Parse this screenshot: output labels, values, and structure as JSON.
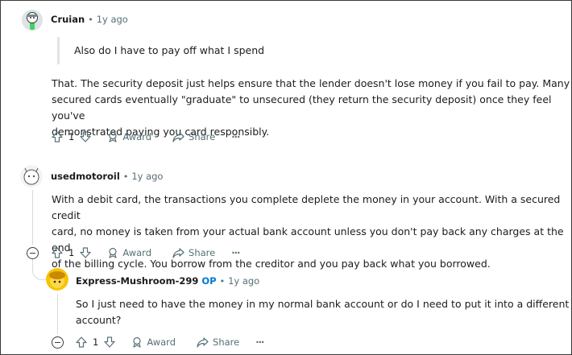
{
  "comments": [
    {
      "author": "Cruian",
      "age": "1y ago",
      "quote": "Also do I have to pay off what I spend",
      "body": [
        "That. The security deposit just helps ensure that the lender doesn't lose money if you fail to pay. Many",
        "secured cards eventually \"graduate\" to unsecured (they return the security deposit) once they feel you've",
        "demonstrated paying you card responsibly."
      ],
      "votes": "1"
    },
    {
      "author": "usedmotoroil",
      "age": "1y ago",
      "body": [
        "With a debit card, the transactions you complete deplete the money in your account. With a secured credit",
        "card, no money is taken from your actual bank account unless you don't pay back any charges at the end",
        "of the billing cycle. You borrow from the creditor and you pay back what you borrowed."
      ],
      "votes": "1"
    },
    {
      "author": "Express-Mushroom-299",
      "badge": "OP",
      "age": "1y ago",
      "body": [
        "So I just need to have the money in my normal bank account or do I need to put it into a different",
        "account?"
      ],
      "votes": "1"
    }
  ],
  "actions": {
    "award_label": "Award",
    "share_label": "Share",
    "more_label": "···"
  },
  "separator": "•",
  "colors": {
    "meta_gray": "#576f76",
    "op_blue": "#0079d3",
    "thread_line": "#d6dadc"
  }
}
